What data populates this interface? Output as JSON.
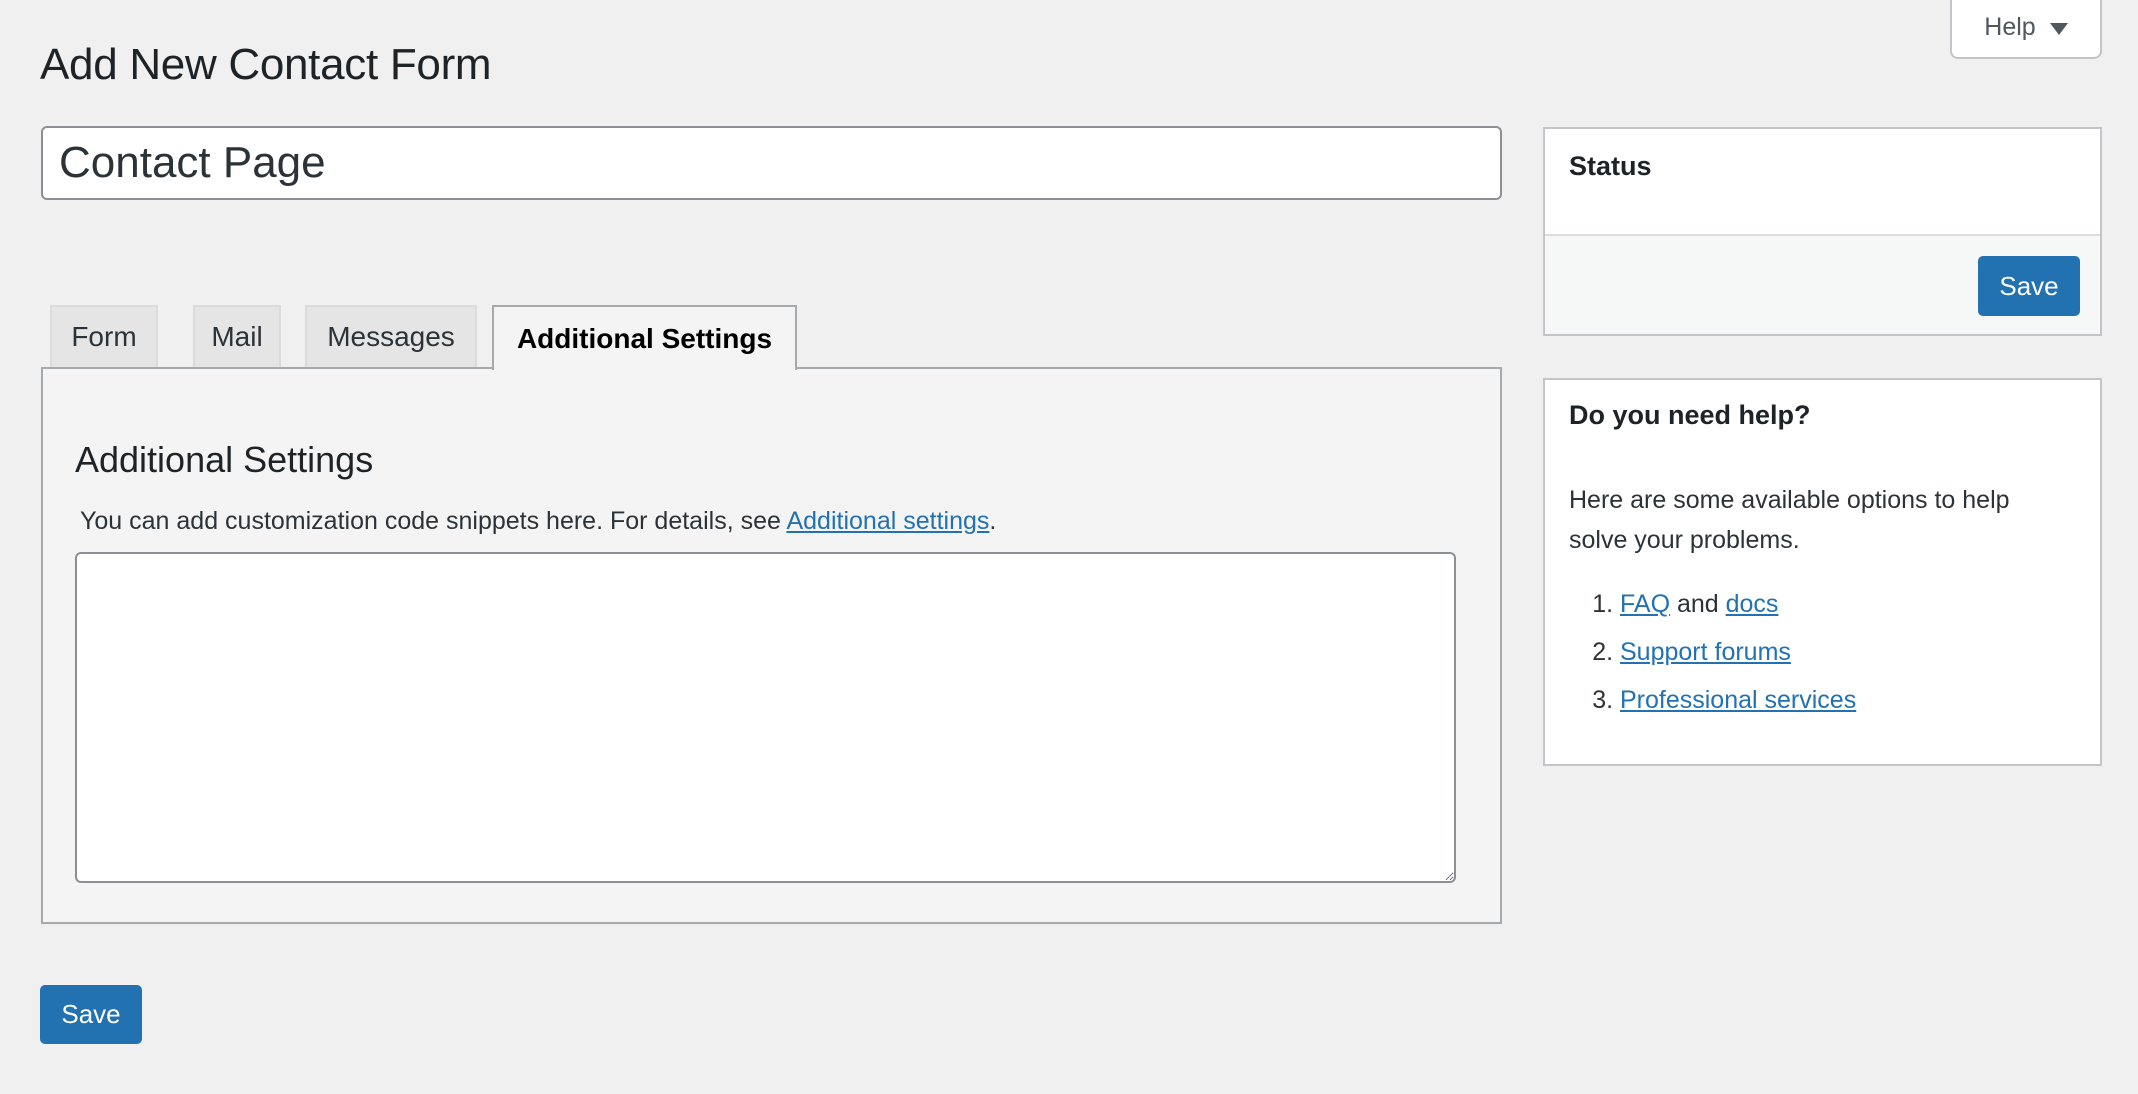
{
  "help_tab": {
    "label": "Help",
    "icon": "triangle-down-icon"
  },
  "page": {
    "title": "Add New Contact Form"
  },
  "form_title": {
    "value": "Contact Page",
    "placeholder": ""
  },
  "tabs": [
    {
      "label": "Form",
      "active": false
    },
    {
      "label": "Mail",
      "active": false
    },
    {
      "label": "Messages",
      "active": false
    },
    {
      "label": "Additional Settings",
      "active": true
    }
  ],
  "panel": {
    "heading": "Additional Settings",
    "description_prefix": "You can add customization code snippets here. For details, see ",
    "description_link": "Additional settings",
    "description_suffix": ".",
    "textarea_value": ""
  },
  "save_label": "Save",
  "status_box": {
    "title": "Status",
    "save_label": "Save"
  },
  "help_box": {
    "title": "Do you need help?",
    "intro": "Here are some available options to help solve your problems.",
    "items": [
      {
        "number": "1.",
        "link1": "FAQ",
        "connector": " and ",
        "link2": "docs"
      },
      {
        "number": "2.",
        "link1": "Support forums"
      },
      {
        "number": "3.",
        "link1": "Professional services"
      }
    ]
  },
  "colors": {
    "accent": "#2271b1",
    "background": "#f0f0f1",
    "text": "#1d2327"
  }
}
